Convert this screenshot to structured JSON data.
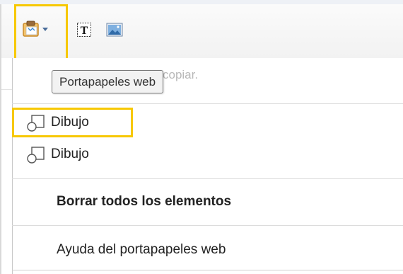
{
  "toolbar": {
    "buttons": [
      {
        "name": "web-clipboard",
        "icon": "clipboard-icon"
      },
      {
        "name": "insert-text",
        "icon": "text-box-icon",
        "glyph": "T"
      },
      {
        "name": "insert-image",
        "icon": "image-icon"
      }
    ],
    "highlight_color": "#f7c800"
  },
  "tooltip": {
    "text": "Portapapeles web"
  },
  "menu": {
    "hint_text": "copiar.",
    "items": [
      {
        "label": "Dibujo",
        "icon": "drawing-shape-icon"
      },
      {
        "label": "Dibujo",
        "icon": "drawing-shape-icon"
      }
    ],
    "clear_all": "Borrar todos los elementos",
    "help": "Ayuda del portapapeles web"
  }
}
